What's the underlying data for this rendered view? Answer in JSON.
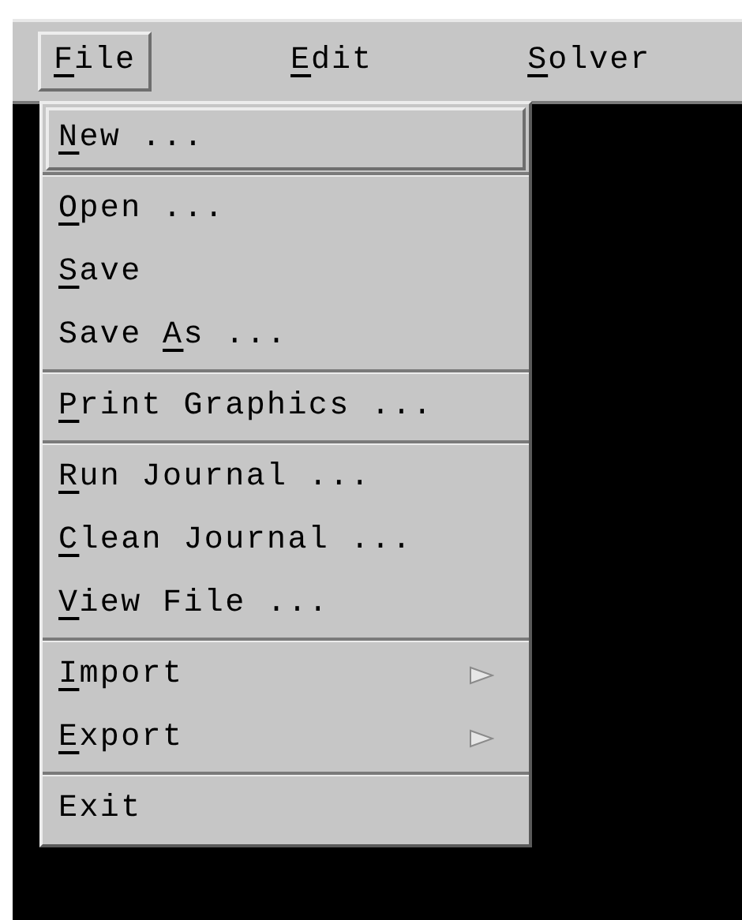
{
  "menubar": [
    {
      "label_parts": [
        {
          "text": "F",
          "underlined": true
        },
        {
          "text": "ile",
          "underlined": false
        }
      ],
      "selected": true
    },
    {
      "label_parts": [
        {
          "text": "E",
          "underlined": true
        },
        {
          "text": "dit",
          "underlined": false
        }
      ],
      "selected": false
    },
    {
      "label_parts": [
        {
          "text": "S",
          "underlined": true
        },
        {
          "text": "olver",
          "underlined": false
        }
      ],
      "selected": false
    }
  ],
  "menu": {
    "groups": [
      {
        "items": [
          {
            "label_parts": [
              {
                "text": "N",
                "underlined": true
              },
              {
                "text": "ew ...",
                "underlined": false
              }
            ],
            "selected": true,
            "kind": "command"
          }
        ]
      },
      {
        "items": [
          {
            "label_parts": [
              {
                "text": "O",
                "underlined": true
              },
              {
                "text": "pen ...",
                "underlined": false
              }
            ],
            "selected": false,
            "kind": "command"
          },
          {
            "label_parts": [
              {
                "text": "S",
                "underlined": true
              },
              {
                "text": "ave",
                "underlined": false
              }
            ],
            "selected": false,
            "kind": "command"
          },
          {
            "label_parts": [
              {
                "text": "Save ",
                "underlined": false
              },
              {
                "text": "A",
                "underlined": true
              },
              {
                "text": "s ...",
                "underlined": false
              }
            ],
            "selected": false,
            "kind": "command"
          }
        ]
      },
      {
        "items": [
          {
            "label_parts": [
              {
                "text": "P",
                "underlined": true
              },
              {
                "text": "rint Graphics ...",
                "underlined": false
              }
            ],
            "selected": false,
            "kind": "command"
          }
        ]
      },
      {
        "items": [
          {
            "label_parts": [
              {
                "text": "R",
                "underlined": true
              },
              {
                "text": "un Journal ...",
                "underlined": false
              }
            ],
            "selected": false,
            "kind": "command"
          },
          {
            "label_parts": [
              {
                "text": "C",
                "underlined": true
              },
              {
                "text": "lean Journal ...",
                "underlined": false
              }
            ],
            "selected": false,
            "kind": "command"
          },
          {
            "label_parts": [
              {
                "text": "V",
                "underlined": true
              },
              {
                "text": "iew File ...",
                "underlined": false
              }
            ],
            "selected": false,
            "kind": "command"
          }
        ]
      },
      {
        "items": [
          {
            "label_parts": [
              {
                "text": "I",
                "underlined": true
              },
              {
                "text": "mport",
                "underlined": false
              }
            ],
            "selected": false,
            "kind": "cascade"
          },
          {
            "label_parts": [
              {
                "text": "E",
                "underlined": true
              },
              {
                "text": "xport",
                "underlined": false
              }
            ],
            "selected": false,
            "kind": "cascade"
          }
        ]
      },
      {
        "items": [
          {
            "label_parts": [
              {
                "text": "Exit",
                "underlined": false
              }
            ],
            "selected": false,
            "kind": "command"
          }
        ]
      }
    ]
  }
}
